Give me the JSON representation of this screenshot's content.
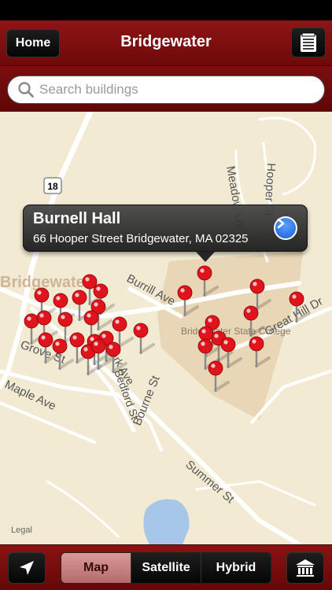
{
  "nav": {
    "home_label": "Home",
    "title": "Bridgewater",
    "list_icon": "list-icon"
  },
  "search": {
    "placeholder": "Search buildings",
    "value": ""
  },
  "map": {
    "street_labels": [
      "Burrill Ave",
      "Grove St",
      "Maple Ave",
      "Bourne St",
      "Summer St",
      "Meadow Ln",
      "Hooper St",
      "Great Hill Dr",
      "Park Ave",
      "Bedford St",
      "Bridgewater",
      "Bridgewater State College",
      "18"
    ],
    "legal_label": "Legal"
  },
  "callout": {
    "title": "Burnell Hall",
    "address": "66 Hooper Street Bridgewater, MA 02325"
  },
  "toolbar": {
    "segments": [
      "Map",
      "Satellite",
      "Hybrid"
    ],
    "selected": "Map"
  },
  "colors": {
    "brand": "#8e1414",
    "pin": "#e0141c"
  }
}
